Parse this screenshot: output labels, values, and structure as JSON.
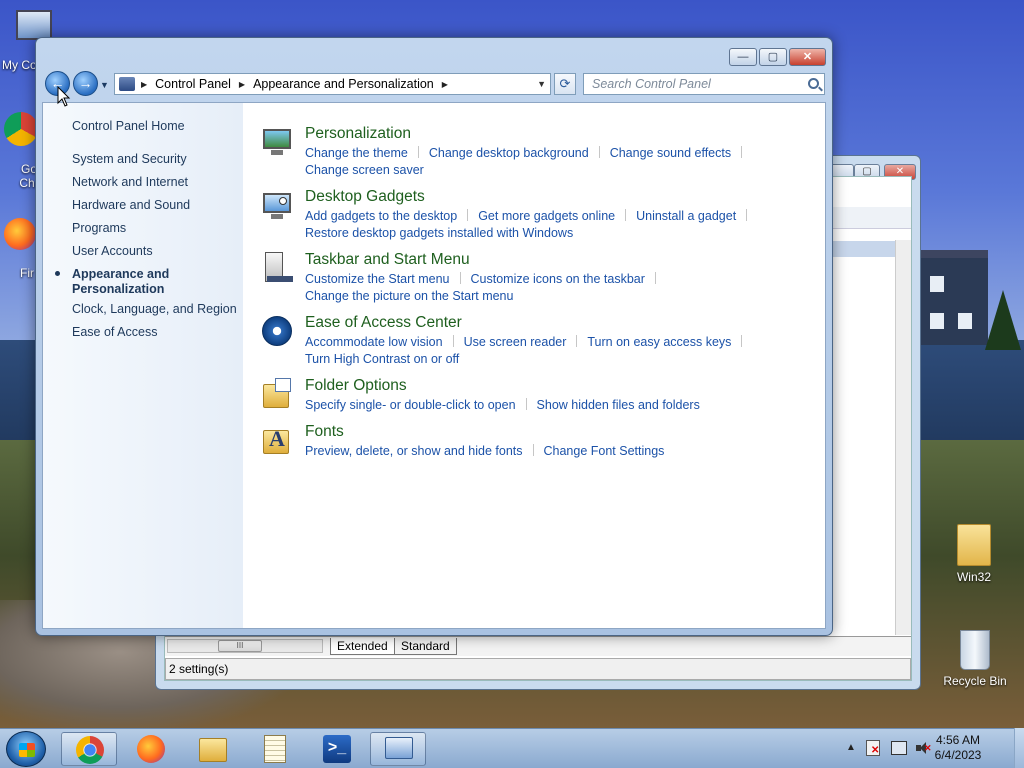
{
  "desktop": {
    "icons": [
      {
        "label": "My Co",
        "icon": "computer-icon"
      },
      {
        "label": "Go Chr",
        "icon": "chrome-icon"
      },
      {
        "label": "Fir",
        "icon": "firefox-icon"
      },
      {
        "label": "Win32",
        "icon": "folder-icon"
      },
      {
        "label": "Recycle Bin",
        "icon": "recycle-bin-icon"
      }
    ]
  },
  "back_window": {
    "tabs": [
      "Extended",
      "Standard"
    ],
    "status": "2 setting(s)",
    "scroll_grip": "III"
  },
  "window": {
    "controls": {
      "minimize": "—",
      "maximize": "▢",
      "close": "✕"
    },
    "breadcrumb": [
      "Control Panel",
      "Appearance and Personalization"
    ],
    "search_placeholder": "Search Control Panel",
    "refresh_glyph": "⟳"
  },
  "sidebar": {
    "home": "Control Panel Home",
    "items": [
      {
        "label": "System and Security",
        "active": false
      },
      {
        "label": "Network and Internet",
        "active": false
      },
      {
        "label": "Hardware and Sound",
        "active": false
      },
      {
        "label": "Programs",
        "active": false
      },
      {
        "label": "User Accounts",
        "active": false
      },
      {
        "label": "Appearance and Personalization",
        "active": true
      },
      {
        "label": "Clock, Language, and Region",
        "active": false
      },
      {
        "label": "Ease of Access",
        "active": false
      }
    ],
    "active_line1": "Appearance and",
    "active_line2": "Personalization"
  },
  "categories": [
    {
      "title": "Personalization",
      "icon": "personalization-icon",
      "links": [
        "Change the theme",
        "Change desktop background",
        "Change sound effects",
        "Change screen saver"
      ]
    },
    {
      "title": "Desktop Gadgets",
      "icon": "gadgets-icon",
      "links": [
        "Add gadgets to the desktop",
        "Get more gadgets online",
        "Uninstall a gadget",
        "Restore desktop gadgets installed with Windows"
      ]
    },
    {
      "title": "Taskbar and Start Menu",
      "icon": "taskbar-icon",
      "links": [
        "Customize the Start menu",
        "Customize icons on the taskbar",
        "Change the picture on the Start menu"
      ]
    },
    {
      "title": "Ease of Access Center",
      "icon": "ease-of-access-icon",
      "links": [
        "Accommodate low vision",
        "Use screen reader",
        "Turn on easy access keys",
        "Turn High Contrast on or off"
      ]
    },
    {
      "title": "Folder Options",
      "icon": "folder-options-icon",
      "links": [
        "Specify single- or double-click to open",
        "Show hidden files and folders"
      ]
    },
    {
      "title": "Fonts",
      "icon": "fonts-icon",
      "links": [
        "Preview, delete, or show and hide fonts",
        "Change Font Settings"
      ]
    }
  ],
  "taskbar": {
    "apps": [
      {
        "name": "chrome",
        "icon": "chrome-icon"
      },
      {
        "name": "firefox",
        "icon": "firefox-icon"
      },
      {
        "name": "explorer",
        "icon": "folder-icon"
      },
      {
        "name": "notepad",
        "icon": "notepad-icon"
      },
      {
        "name": "powershell",
        "icon": "powershell-icon"
      },
      {
        "name": "control-panel",
        "icon": "control-panel-icon"
      }
    ],
    "clock_time": "4:56 AM",
    "clock_date": "6/4/2023"
  }
}
